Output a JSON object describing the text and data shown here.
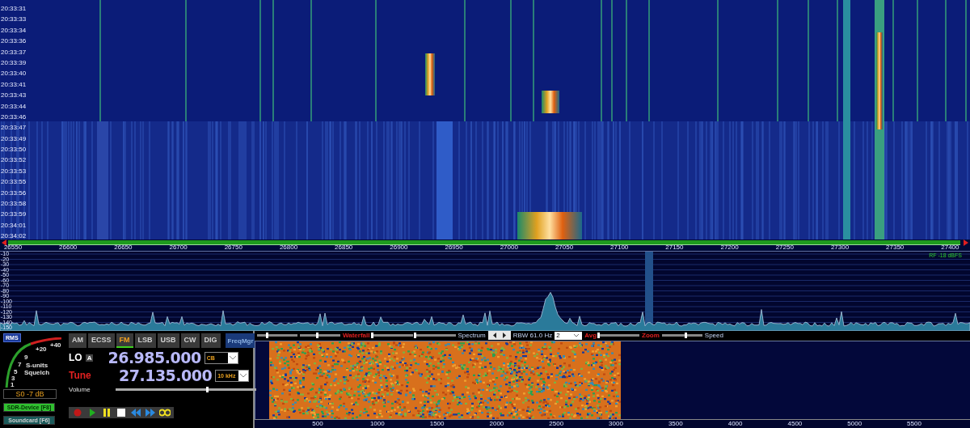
{
  "waterfall": {
    "times": [
      "20:33:31",
      "20:33:33",
      "20:33:34",
      "20:33:36",
      "20:33:37",
      "20:33:39",
      "20:33:40",
      "20:33:41",
      "20:33:43",
      "20:33:44",
      "20:33:46",
      "20:33:47",
      "20:33:49",
      "20:33:50",
      "20:33:52",
      "20:33:53",
      "20:33:55",
      "20:33:56",
      "20:33:58",
      "20:33:59",
      "20:34:01",
      "20:34:02"
    ]
  },
  "frequency_axis": {
    "labels": [
      "26550",
      "26600",
      "26650",
      "26700",
      "26750",
      "26800",
      "26850",
      "26900",
      "26950",
      "27000",
      "27050",
      "27100",
      "27150",
      "27200",
      "27250",
      "27300",
      "27350",
      "27400"
    ]
  },
  "spectrum": {
    "db_labels": [
      "-10",
      "-20",
      "-30",
      "-40",
      "-50",
      "-60",
      "-70",
      "-80",
      "-90",
      "-100",
      "-110",
      "-120",
      "-130",
      "-140",
      "-150"
    ],
    "rf_reading": "RF -18 dBFS"
  },
  "receiver": {
    "rms_button": "RMS",
    "s_meter": {
      "scale": [
        "+40",
        "+20",
        "9",
        "7",
        "5",
        "3",
        "1"
      ],
      "units": "S-units",
      "squelch": "Squelch",
      "reading": "S0 -7 dB"
    },
    "devices": [
      {
        "label": "SDR-Device [F8]",
        "selected": true
      },
      {
        "label": "Soundcard [F6]",
        "selected": false
      }
    ],
    "modes": [
      {
        "label": "AM",
        "selected": false
      },
      {
        "label": "ECSS",
        "selected": false
      },
      {
        "label": "FM",
        "selected": true
      },
      {
        "label": "LSB",
        "selected": false
      },
      {
        "label": "USB",
        "selected": false
      },
      {
        "label": "CW",
        "selected": false
      },
      {
        "label": "DIG",
        "selected": false
      }
    ],
    "freqmgr": "FreqMgr",
    "lo": {
      "label": "LO",
      "badge": "A",
      "frequency": "26.985.000",
      "band": "CB"
    },
    "tune": {
      "label": "Tune",
      "frequency": "27.135.000",
      "step": "10 kHz"
    },
    "volume": {
      "label": "Volume",
      "level": 0.66
    },
    "transport": [
      {
        "kind": "record"
      },
      {
        "kind": "play"
      },
      {
        "kind": "pause"
      },
      {
        "kind": "stop"
      },
      {
        "kind": "rewind"
      },
      {
        "kind": "forward"
      },
      {
        "kind": "loop"
      }
    ]
  },
  "audio": {
    "toolbar": [
      {
        "kind": "slider",
        "level": 0.28
      },
      {
        "kind": "slider",
        "level": 0.45
      },
      {
        "kind": "label",
        "text": "Waterfall",
        "highlighted": true
      },
      {
        "kind": "slider",
        "level": 0.02
      },
      {
        "kind": "slider",
        "level": 0.02
      },
      {
        "kind": "label",
        "text": "Spectrum",
        "highlighted": false
      },
      {
        "kind": "arrows"
      },
      {
        "kind": "label",
        "text": "RBW 61.0 Hz",
        "highlighted": false
      },
      {
        "kind": "select",
        "value": "2"
      },
      {
        "kind": "label",
        "text": "Avg",
        "highlighted": true
      },
      {
        "kind": "slider",
        "level": 0.02
      },
      {
        "kind": "label",
        "text": "Zoom",
        "highlighted": true
      },
      {
        "kind": "slider",
        "level": 0.62
      },
      {
        "kind": "label",
        "text": "Speed",
        "highlighted": false
      }
    ],
    "axis": [
      "500",
      "1000",
      "1500",
      "2000",
      "2500",
      "3000",
      "3500",
      "4000",
      "4500",
      "5000",
      "5500"
    ]
  }
}
